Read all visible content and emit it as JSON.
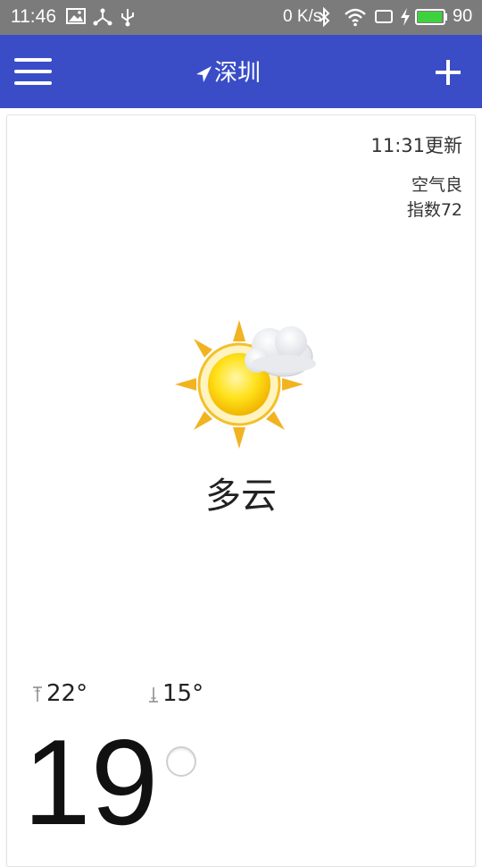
{
  "status_bar": {
    "time": "11:46",
    "net_speed": "0 K/s",
    "battery_level": "90",
    "icons": [
      "image-icon",
      "usb-tether-icon",
      "usb-icon",
      "bluetooth-icon",
      "wifi-icon",
      "screen-icon",
      "charging-icon",
      "battery-icon"
    ]
  },
  "app_bar": {
    "city": "深圳",
    "menu_icon": "menu-icon",
    "location_icon": "location-arrow-icon",
    "add_icon": "add-icon",
    "color": "#3a4dc7"
  },
  "weather": {
    "update_time": "11:31更新",
    "air_quality": "空气良",
    "aqi": "指数72",
    "condition": "多云",
    "high": "22°",
    "low": "15°",
    "current_temp": "19",
    "icon": "partly-cloudy-icon"
  }
}
